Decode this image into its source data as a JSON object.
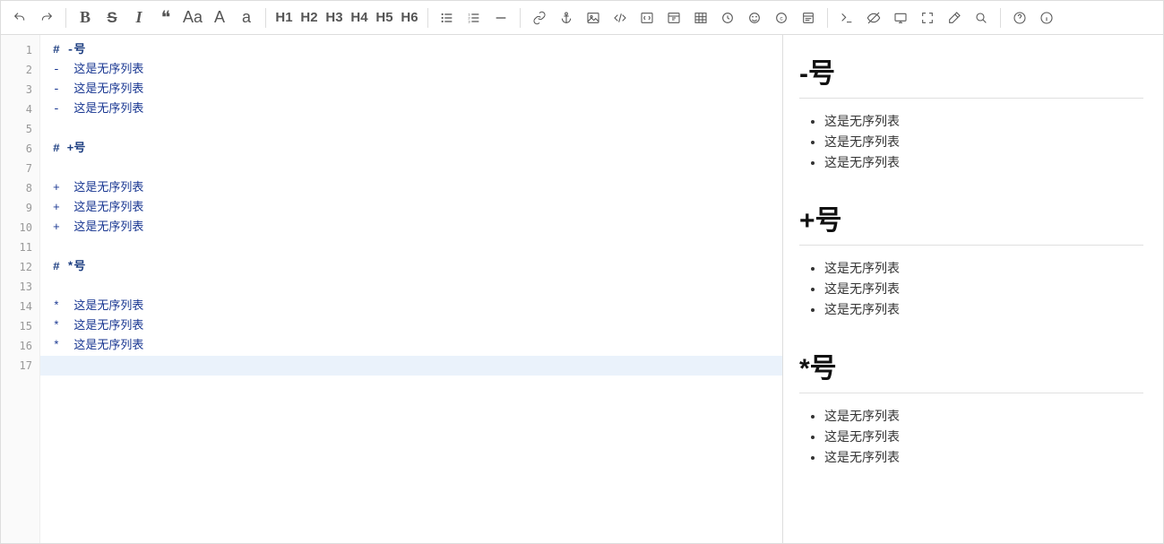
{
  "toolbar": {
    "undo": "↺",
    "redo": "↻",
    "bold": "B",
    "strike": "S",
    "italic": "I",
    "quote": "❝",
    "cap": "Aa",
    "upper": "A",
    "lower": "a",
    "h1": "H1",
    "h2": "H2",
    "h3": "H3",
    "h4": "H4",
    "h5": "H5",
    "h6": "H6"
  },
  "editor": {
    "line_count": 17,
    "active_line": 17,
    "lines": [
      {
        "type": "header",
        "raw": "# -号"
      },
      {
        "type": "bullet",
        "marker": "-",
        "text": "这是无序列表"
      },
      {
        "type": "bullet",
        "marker": "-",
        "text": "这是无序列表"
      },
      {
        "type": "bullet",
        "marker": "-",
        "text": "这是无序列表"
      },
      {
        "type": "blank",
        "raw": ""
      },
      {
        "type": "header",
        "raw": "# +号"
      },
      {
        "type": "blank",
        "raw": ""
      },
      {
        "type": "bullet",
        "marker": "+",
        "text": "这是无序列表"
      },
      {
        "type": "bullet",
        "marker": "+",
        "text": "这是无序列表"
      },
      {
        "type": "bullet",
        "marker": "+",
        "text": "这是无序列表"
      },
      {
        "type": "blank",
        "raw": ""
      },
      {
        "type": "header",
        "raw": "# *号"
      },
      {
        "type": "blank",
        "raw": ""
      },
      {
        "type": "bullet",
        "marker": "*",
        "text": "这是无序列表"
      },
      {
        "type": "bullet",
        "marker": "*",
        "text": "这是无序列表"
      },
      {
        "type": "bullet",
        "marker": "*",
        "text": "这是无序列表"
      },
      {
        "type": "blank",
        "raw": ""
      }
    ]
  },
  "preview": {
    "sections": [
      {
        "title": "-号",
        "items": [
          "这是无序列表",
          "这是无序列表",
          "这是无序列表"
        ]
      },
      {
        "title": "+号",
        "items": [
          "这是无序列表",
          "这是无序列表",
          "这是无序列表"
        ]
      },
      {
        "title": "*号",
        "items": [
          "这是无序列表",
          "这是无序列表",
          "这是无序列表"
        ]
      }
    ]
  }
}
